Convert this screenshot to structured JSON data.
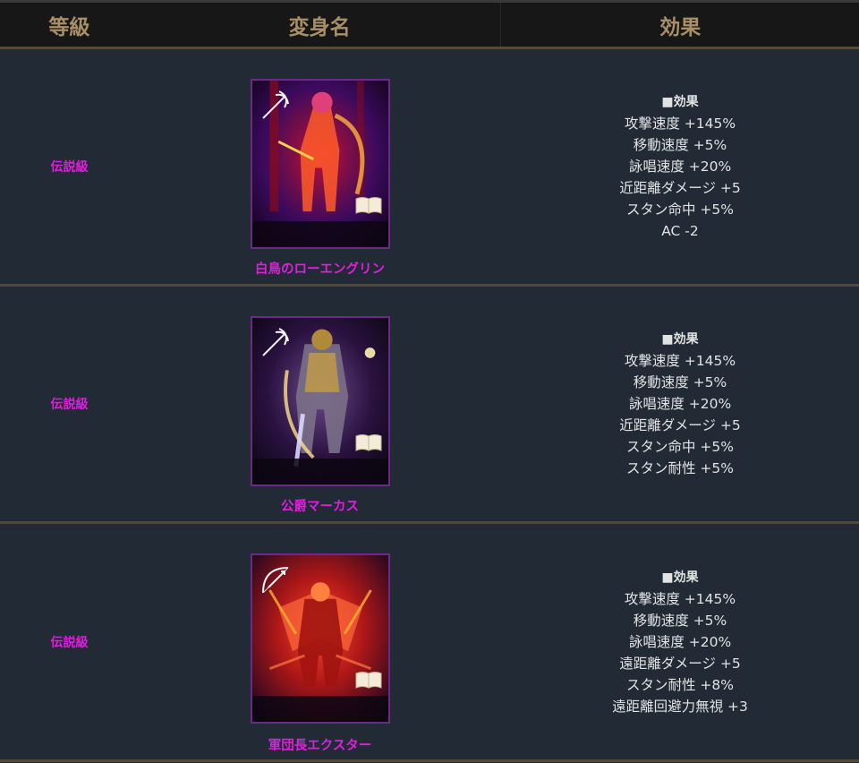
{
  "header": {
    "grade": "等級",
    "name": "変身名",
    "effect": "効果"
  },
  "rows": [
    {
      "grade": "伝説級",
      "name": "白鳥のローエングリン",
      "effects_title": "■効果",
      "effects": [
        "攻撃速度 +145%",
        "移動速度 +5%",
        "詠唱速度 +20%",
        "近距離ダメージ +5",
        "スタン命中 +5%",
        "AC -2"
      ],
      "card_colors": {
        "bg1": "#3b0a5e",
        "bg2": "#c0122f",
        "figure": "#ff6a2a",
        "accent": "#ffd24a"
      }
    },
    {
      "grade": "伝説級",
      "name": "公爵マーカス",
      "effects_title": "■効果",
      "effects": [
        "攻撃速度 +145%",
        "移動速度 +5%",
        "詠唱速度 +20%",
        "近距離ダメージ +5",
        "スタン命中 +5%",
        "スタン耐性 +5%"
      ],
      "card_colors": {
        "bg1": "#2a1240",
        "bg2": "#5a2a70",
        "figure": "#c8c0e8",
        "accent": "#ffd870"
      }
    },
    {
      "grade": "伝説級",
      "name": "軍団長エクスター",
      "effects_title": "■効果",
      "effects": [
        "攻撃速度 +145%",
        "移動速度 +5%",
        "詠唱速度 +20%",
        "遠距離ダメージ +5",
        "スタン耐性 +8%",
        "遠距離回避力無視 +3"
      ],
      "card_colors": {
        "bg1": "#2a0a30",
        "bg2": "#b01818",
        "figure": "#ff3a2a",
        "accent": "#ffb030"
      }
    }
  ]
}
